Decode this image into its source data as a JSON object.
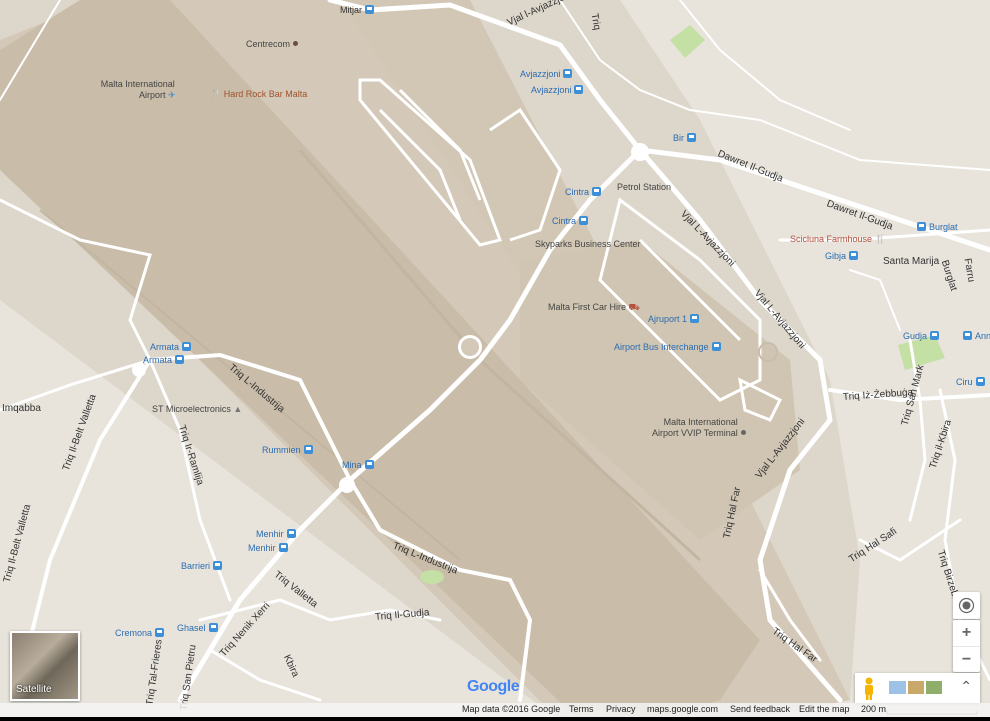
{
  "labels": {
    "mitjar": "Mitjar",
    "centrecom": "Centrecom",
    "malta_intl_airport": "Malta International",
    "malta_intl_airport_2": "Airport",
    "hard_rock": "Hard Rock Bar Malta",
    "avjazzjoni_1": "Avjazzjoni",
    "avjazzjoni_2": "Avjazzjoni",
    "bir": "Bir",
    "cintra_1": "Cintra",
    "petrol_station": "Petrol Station",
    "cintra_2": "Cintra",
    "skyparks": "Skyparks Business Center",
    "scicluna": "Scicluna Farmhouse",
    "burglat": "Burglat",
    "gibja": "Gibja",
    "santa_marija": "Santa Marija",
    "gudja": "Gudja",
    "annunzj": "Annun",
    "malta_first": "Malta First Car Hire",
    "ajruport1": "Ajruport 1",
    "airport_bus": "Airport Bus Interchange",
    "vvip": "Malta International",
    "vvip_2": "Airport VVIP Terminal",
    "ciru": "Ciru",
    "armata_1": "Armata",
    "armata_2": "Armata",
    "imqabba": "Imqabba",
    "st_micro": "ST Microelectronics",
    "rummien": "Rummien",
    "mina": "Mina",
    "menhir_1": "Menhir",
    "menhir_2": "Menhir",
    "barrieri": "Barrieri",
    "cremona": "Cremona",
    "ghasel": "Ghasel"
  },
  "streets": {
    "vjal_avjazzjoni_top": "Vjal l-Avjazzjoni",
    "dawret_gudja_1": "Dawret Il-Gudja",
    "dawret_gudja_2": "Dawret Il-Gudja",
    "vjal_avjazzjoni_mid": "Vjal L-Avjazzjoni",
    "vjal_avjazzjoni_right": "Vjal L-Avjazzjoni",
    "vjal_avjazzjoni_low": "Vjal L-Avjazzjoni",
    "triq_industrija_1": "Triq L-Industrija",
    "triq_industrija_2": "Triq L-Industrija",
    "triq_zebbuga": "Triq Iż-Żebbuġa",
    "triq_san_mark": "Triq San Mark",
    "triq_il_kbira": "Triq il-Kbira",
    "triq_hal_far_1": "Triq Hal Far",
    "triq_hal_far_2": "Triq Hal Far",
    "triq_hal_safi": "Triq Hal Safi",
    "triq_birzebbuga": "Triq Birzebbuġa",
    "triq_ramlija": "Triq Ir-Ramlija",
    "triq_belt_valletta_1": "Triq Il-Belt Valletta",
    "triq_belt_valletta_2": "Triq Il-Belt Valletta",
    "triq_valletta": "Triq Valletta",
    "triq_il_gudja": "Triq Il-Gudja",
    "triq_nenik": "Triq Nenik Xerri",
    "kbira": "Kbira",
    "triq_tal_frieres": "Triq Tal-Frieres",
    "triq_san_pietru": "Triq San Pietru",
    "burglat_st": "Burglat",
    "farrug": "Farru",
    "triq_top": "Triq"
  },
  "controls": {
    "zoom_in": "+",
    "zoom_out": "−",
    "satellite_label": "Satellite",
    "expand": "⌃"
  },
  "footer": {
    "map_data": "Map data ©2016 Google",
    "terms": "Terms",
    "privacy": "Privacy",
    "site": "maps.google.com",
    "feedback": "Send feedback",
    "edit": "Edit the map",
    "scale": "200 m"
  },
  "logo": "Google",
  "colors": {
    "land": "#e8e4dc",
    "airport": "#d8d0c4",
    "runway": "#cbbfac",
    "road": "#ffffff",
    "park": "#c5e0a5",
    "transit": "#3d8fd8"
  }
}
